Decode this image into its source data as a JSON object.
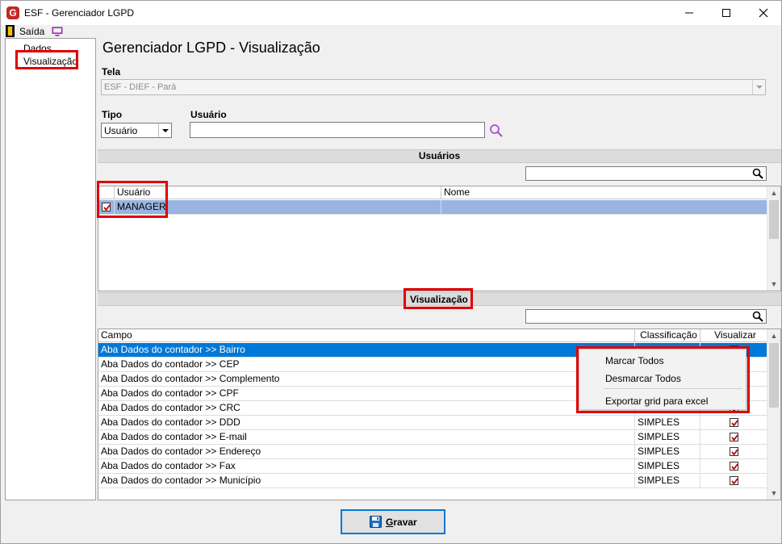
{
  "window": {
    "title": "ESF - Gerenciador LGPD",
    "app_icon_letter": "G"
  },
  "menubar": {
    "exit_label": "Saída"
  },
  "sidebar": {
    "items": [
      {
        "label": "Dados"
      },
      {
        "label": "Visualização"
      }
    ]
  },
  "main": {
    "title": "Gerenciador LGPD - Visualização",
    "tela_label": "Tela",
    "tela_value": "ESF - DIEF - Pará",
    "tipo_label": "Tipo",
    "tipo_value": "Usuário",
    "usuario_label": "Usuário",
    "usuario_value": ""
  },
  "users_section": {
    "title": "Usuários",
    "filter_value": "",
    "columns": [
      "Usuário",
      "Nome"
    ],
    "rows": [
      {
        "usuario": "MANAGER",
        "nome": "",
        "checked": true
      }
    ]
  },
  "vis_section": {
    "title": "Visualização",
    "filter_value": "",
    "columns": [
      "Campo",
      "Classificação",
      "Visualizar"
    ],
    "rows": [
      {
        "campo": "Aba Dados do contador >> Bairro",
        "classificacao": "",
        "visualizar": true
      },
      {
        "campo": "Aba Dados do contador >> CEP",
        "classificacao": "",
        "visualizar": true
      },
      {
        "campo": "Aba Dados do contador >> Complemento",
        "classificacao": "",
        "visualizar": true
      },
      {
        "campo": "Aba Dados do contador >> CPF",
        "classificacao": "",
        "visualizar": true
      },
      {
        "campo": "Aba Dados do contador >> CRC",
        "classificacao": "",
        "visualizar": true
      },
      {
        "campo": "Aba Dados do contador >> DDD",
        "classificacao": "SIMPLES",
        "visualizar": true
      },
      {
        "campo": "Aba Dados do contador >> E-mail",
        "classificacao": "SIMPLES",
        "visualizar": true
      },
      {
        "campo": "Aba Dados do contador >> Endereço",
        "classificacao": "SIMPLES",
        "visualizar": true
      },
      {
        "campo": "Aba Dados do contador >> Fax",
        "classificacao": "SIMPLES",
        "visualizar": true
      },
      {
        "campo": "Aba Dados do contador >> Município",
        "classificacao": "SIMPLES",
        "visualizar": true
      }
    ]
  },
  "context_menu": {
    "items": [
      "Marcar Todos",
      "Desmarcar Todos",
      "Exportar grid para excel"
    ]
  },
  "footer": {
    "save_label": "Gravar"
  },
  "colors": {
    "highlight_red": "#e00000",
    "selection_blue": "#0078d7",
    "selection_light": "#99b4e0",
    "check_red": "#c00000"
  }
}
